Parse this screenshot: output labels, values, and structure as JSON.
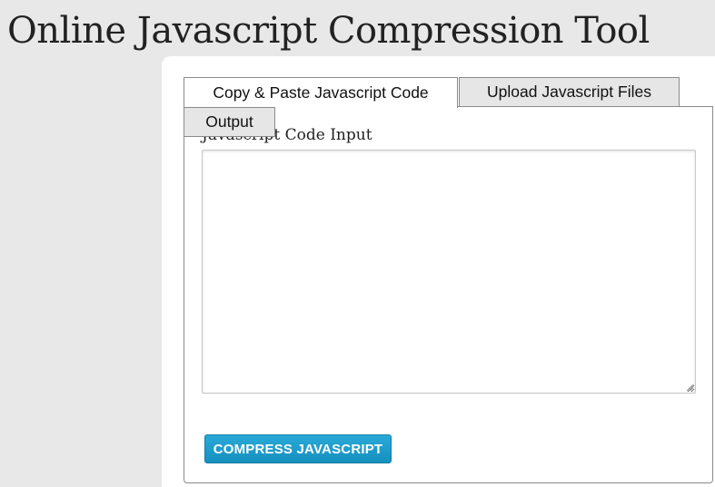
{
  "page": {
    "title": "Online Javascript Compression Tool"
  },
  "tabs": [
    {
      "label": "Copy & Paste Javascript Code",
      "active": true
    },
    {
      "label": "Upload Javascript Files",
      "active": false
    },
    {
      "label": "Output",
      "active": false
    }
  ],
  "form": {
    "input_label": "Javascript Code Input",
    "textarea_value": "",
    "textarea_placeholder": "",
    "submit_label": "COMPRESS JAVASCRIPT"
  },
  "colors": {
    "page_background": "#e8e8e8",
    "button_accent": "#1a99c9",
    "inactive_tab": "#e6e6e6"
  },
  "icons": {
    "resize_grip": "resize-grip-icon"
  }
}
